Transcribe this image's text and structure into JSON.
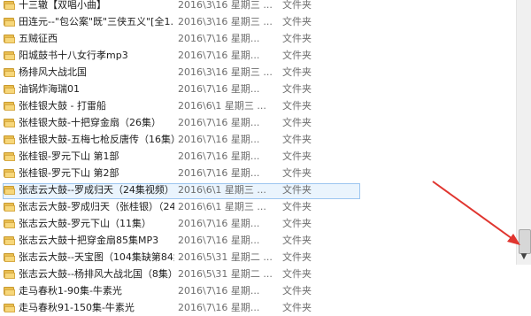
{
  "files": [
    {
      "name": "十三辙【双唱小曲】",
      "date": "2016\\3\\16 星期三 ...",
      "type": "文件夹"
    },
    {
      "name": "田连元--\"包公案\"既\"三侠五义\"[全1...",
      "date": "2016\\3\\16 星期三 ...",
      "type": "文件夹"
    },
    {
      "name": "五贼征西",
      "date": "2016\\7\\16 星期...",
      "type": "文件夹"
    },
    {
      "name": "阳城鼓书十八女行孝mp3",
      "date": "2016\\7\\16 星期...",
      "type": "文件夹"
    },
    {
      "name": "杨排风大战北国",
      "date": "2016\\3\\16 星期三 ...",
      "type": "文件夹"
    },
    {
      "name": "油锅炸海瑞01",
      "date": "2016\\7\\16 星期...",
      "type": "文件夹"
    },
    {
      "name": "张桂银大鼓 - 打雷船",
      "date": "2016\\6\\1 星期三 ...",
      "type": "文件夹"
    },
    {
      "name": "张桂银大鼓-十把穿金扇（26集）",
      "date": "2016\\7\\16 星期...",
      "type": "文件夹"
    },
    {
      "name": "张桂银大鼓-五梅七枪反唐传（16集）",
      "date": "2016\\7\\16 星期...",
      "type": "文件夹"
    },
    {
      "name": "张桂银-罗元下山 第1部",
      "date": "2016\\7\\16 星期...",
      "type": "文件夹"
    },
    {
      "name": "张桂银-罗元下山 第2部",
      "date": "2016\\7\\16 星期...",
      "type": "文件夹"
    },
    {
      "name": "张志云大鼓--罗成归天（24集视频）",
      "date": "2016\\6\\1 星期三 ...",
      "type": "文件夹",
      "selected": true
    },
    {
      "name": "张志云大鼓-罗成归天（张桂银）（24集...",
      "date": "2016\\6\\1 星期三 ...",
      "type": "文件夹"
    },
    {
      "name": "张志云大鼓-罗元下山（11集）",
      "date": "2016\\7\\16 星期...",
      "type": "文件夹"
    },
    {
      "name": "张志云大鼓十把穿金扇85集MP3",
      "date": "2016\\7\\16 星期...",
      "type": "文件夹"
    },
    {
      "name": "张志云大鼓--天宝图（104集缺第84集）",
      "date": "2016\\5\\31 星期二 ...",
      "type": "文件夹"
    },
    {
      "name": "张志云大鼓--杨排风大战北国（8集）",
      "date": "2016\\5\\31 星期二 ...",
      "type": "文件夹"
    },
    {
      "name": "走马春秋1-90集-牛素光",
      "date": "2016\\7\\16 星期...",
      "type": "文件夹"
    },
    {
      "name": "走马春秋91-150集-牛素光",
      "date": "2016\\7\\16 星期...",
      "type": "文件夹"
    }
  ],
  "scrollbar": {
    "down_arrow": "▼",
    "position": 0.93
  },
  "colors": {
    "folder": "#f7d77a",
    "selection": "#eaf4fd",
    "arrow": "#e0352f"
  }
}
